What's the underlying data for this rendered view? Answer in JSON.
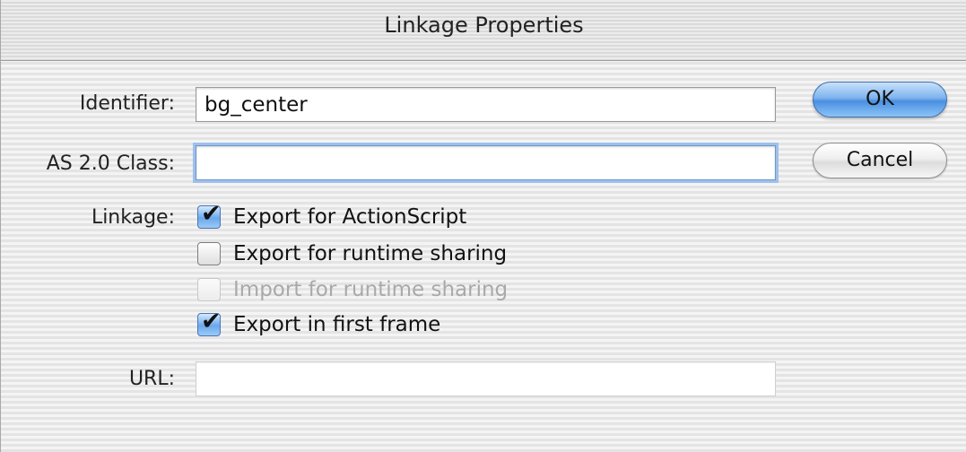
{
  "window": {
    "title": "Linkage Properties"
  },
  "identifier": {
    "label": "Identifier:",
    "value": "bg_center"
  },
  "class_field": {
    "label": "AS 2.0 Class:",
    "value": ""
  },
  "linkage": {
    "label": "Linkage:",
    "options": [
      {
        "label": "Export for ActionScript",
        "checked": true,
        "enabled": true,
        "check_glyph": "✔"
      },
      {
        "label": "Export for runtime sharing",
        "checked": false,
        "enabled": true,
        "check_glyph": ""
      },
      {
        "label": "Import for runtime sharing",
        "checked": false,
        "enabled": false,
        "check_glyph": ""
      },
      {
        "label": "Export in first frame",
        "checked": true,
        "enabled": true,
        "check_glyph": "✔"
      }
    ]
  },
  "url": {
    "label": "URL:",
    "value": ""
  },
  "buttons": {
    "ok": "OK",
    "cancel": "Cancel"
  },
  "colors": {
    "ok_button": "#6fa8ea",
    "focus_ring": "#9fc0ec",
    "disabled_text": "#a9a9a9"
  }
}
